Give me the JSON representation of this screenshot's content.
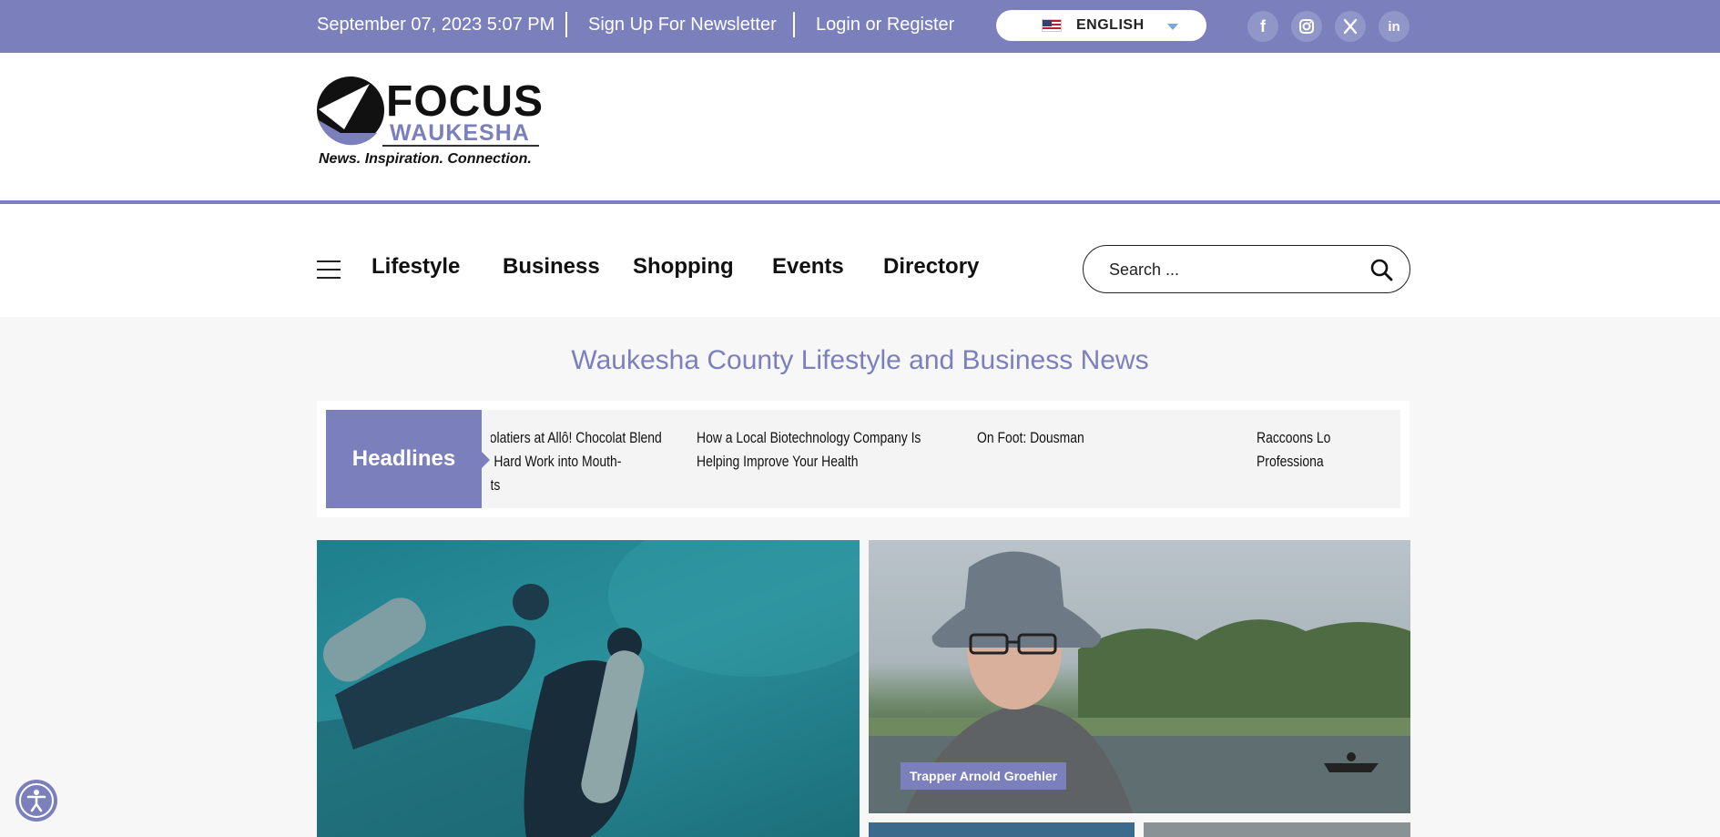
{
  "topbar": {
    "datetime": "September 07, 2023 5:07 PM",
    "newsletter": "Sign Up For Newsletter",
    "login": "Login or Register",
    "language": "ENGLISH",
    "social": [
      "f",
      "ig",
      "X",
      "in"
    ]
  },
  "logo": {
    "focus": "FOCUS",
    "waukesha": "WAUKESHA",
    "tagline": "News. Inspiration. Connection."
  },
  "nav": {
    "items": [
      "Lifestyle",
      "Business",
      "Shopping",
      "Events",
      "Directory"
    ],
    "search_placeholder": "Search ..."
  },
  "section_title": "Waukesha County Lifestyle and Business News",
  "headlines": {
    "label": "Headlines",
    "items": [
      "ocolatiers at Allô! Chocolat Blend\nnd Hard Work into Mouth-\neats",
      "How a Local Biotechnology Company Is\nHelping Improve Your Health",
      "On Foot: Dousman",
      "Raccoons Lo\nProfessiona"
    ]
  },
  "features": {
    "trapper_caption": "Trapper Arnold Groehler"
  },
  "colors": {
    "brand": "#7b80bc",
    "text": "#111111"
  }
}
